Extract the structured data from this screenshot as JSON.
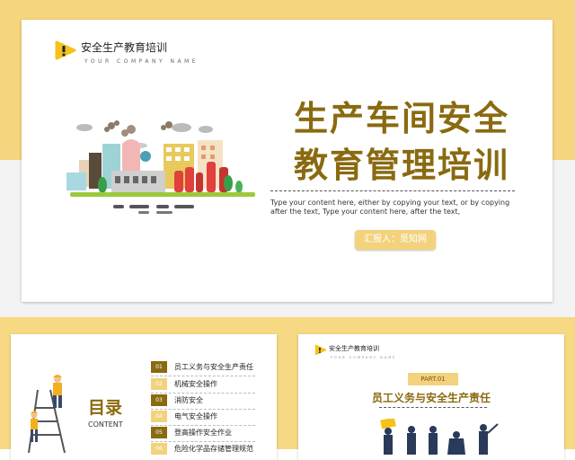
{
  "main_slide": {
    "logo_title": "安全生产教育培训",
    "logo_sub": "YOUR COMPANY NAME",
    "title_line1": "生产车间安全",
    "title_line2": "教育管理培训",
    "description": "Type your content here, either by copying your text, or by copying after the text, Type your content here, after the text,",
    "reporter_label": "汇报人：觅知网"
  },
  "toc_slide": {
    "title": "目录",
    "subtitle": "CONTENT",
    "items": [
      {
        "num": "01",
        "label": "员工义务与安全生产责任"
      },
      {
        "num": "02",
        "label": "机械安全操作"
      },
      {
        "num": "03",
        "label": "消防安全"
      },
      {
        "num": "04",
        "label": "电气安全操作"
      },
      {
        "num": "05",
        "label": "登高操作安全作业"
      },
      {
        "num": "06",
        "label": "危险化学品存储管理规范"
      }
    ]
  },
  "part_slide": {
    "logo_title": "安全生产教育培训",
    "logo_sub": "YOUR COMPANY NAME",
    "badge": "PART.01",
    "title": "员工义务与安全生产责任"
  },
  "colors": {
    "accent_gold": "#8a6a10",
    "accent_yellow": "#f2d27c",
    "band_yellow": "#f7d883"
  }
}
